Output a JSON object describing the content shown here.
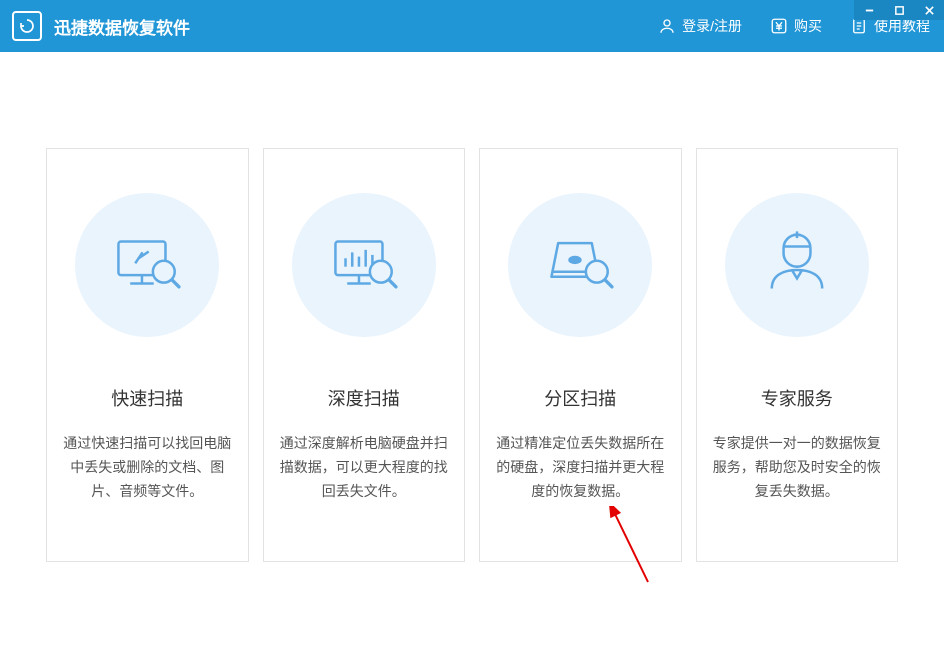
{
  "app": {
    "title": "迅捷数据恢复软件"
  },
  "header": {
    "login": "登录/注册",
    "buy": "购买",
    "tutorial": "使用教程"
  },
  "cards": [
    {
      "title": "快速扫描",
      "desc": "通过快速扫描可以找回电脑中丢失或删除的文档、图片、音频等文件。"
    },
    {
      "title": "深度扫描",
      "desc": "通过深度解析电脑硬盘并扫描数据，可以更大程度的找回丢失文件。"
    },
    {
      "title": "分区扫描",
      "desc": "通过精准定位丢失数据所在的硬盘，深度扫描并更大程度的恢复数据。"
    },
    {
      "title": "专家服务",
      "desc": "专家提供一对一的数据恢复服务，帮助您及时安全的恢复丢失数据。"
    }
  ]
}
